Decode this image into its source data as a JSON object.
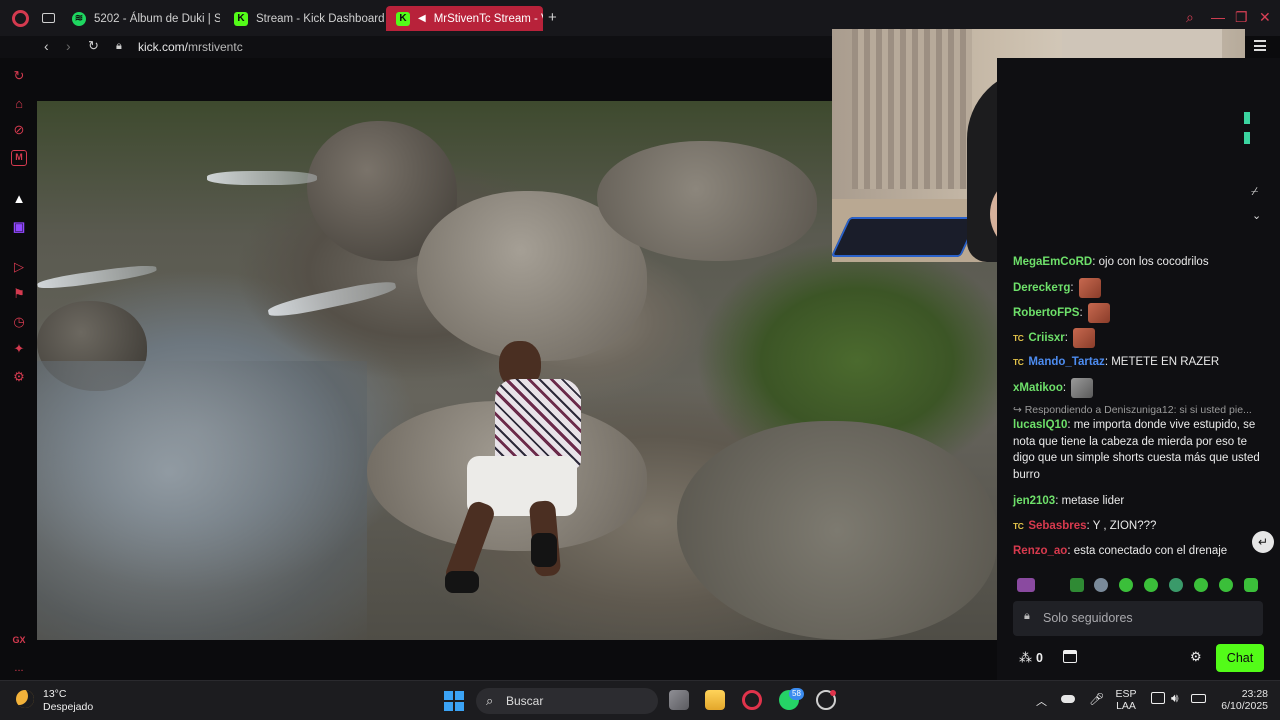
{
  "browser": {
    "tabs": [
      {
        "label": "5202 - Álbum de Duki | Sp",
        "favicon": "spotify-icon",
        "active": false
      },
      {
        "label": "Stream - Kick Dashboard",
        "favicon": "kick-icon",
        "active": false
      },
      {
        "label": "MrStivenTc Stream - V",
        "favicon": "kick-icon",
        "active": true
      }
    ],
    "new_tab": "+",
    "url_host": "kick.com/",
    "url_path": "mrstiventc"
  },
  "sidebar": {
    "icons": [
      "refresh-icon",
      "bag-icon",
      "ban-icon",
      "m-app-icon",
      "kick-icon",
      "twitch-icon",
      "play-icon",
      "pin-icon",
      "history-icon",
      "extensions-icon",
      "settings-icon",
      "gx-icon",
      "more-icon"
    ],
    "gx_label": "GX",
    "more_label": "..."
  },
  "chat": {
    "messages": [
      {
        "user": "MegaEmCoRD",
        "badge": "",
        "text": "ojo con los cocodrilos",
        "user_color": "#6ee06a"
      },
      {
        "user": "Dereckeтg",
        "badge": "",
        "text": "",
        "emote": true,
        "user_color": "#6ee06a"
      },
      {
        "user": "RobertoFPS",
        "badge": "",
        "text": "",
        "emote": true,
        "user_color": "#6ee06a"
      },
      {
        "user": "Criisxr",
        "badge": "TC",
        "text": "",
        "emote": true,
        "user_color": "#6ee06a"
      },
      {
        "user": "Mando_Tartaz",
        "badge": "TC",
        "text": "METETE EN RAZER",
        "user_color": "#4d8cf0"
      },
      {
        "user": "xMatikoo",
        "badge": "",
        "text": "",
        "emote": true,
        "user_color": "#6ee06a"
      },
      {
        "reply_to": "Respondiendo a Deniszuniga12: si si usted pie..."
      },
      {
        "user": "lucaslQ10",
        "badge": "",
        "text": "me importa donde vive estupido, se nota que tiene la cabeza de mierda por eso te digo que un simple shorts cuesta más que usted burro",
        "user_color": "#6ee06a"
      },
      {
        "user": "jen2103",
        "badge": "",
        "text": "metase lider",
        "user_color": "#6ee06a"
      },
      {
        "user": "Sebasbres",
        "badge": "TC",
        "text": "Y , ZION???",
        "user_color": "#d83a4e"
      },
      {
        "user": "Renzo_ao",
        "badge": "",
        "text": "esta conectado con el drenaje",
        "user_color": "#d83a4e"
      }
    ],
    "input_placeholder": "Solo seguidores",
    "points": "0",
    "send_label": "Chat"
  },
  "taskbar": {
    "weather_temp": "13°C",
    "weather_desc": "Despejado",
    "search_label": "Buscar",
    "whatsapp_badge": "58",
    "language": "ESP",
    "layout": "LAA",
    "time": "23:28",
    "date": "6/10/2025"
  },
  "colors": {
    "accent": "#b8223a",
    "kick_green": "#53fc18",
    "opera_red": "#d43a4f"
  }
}
